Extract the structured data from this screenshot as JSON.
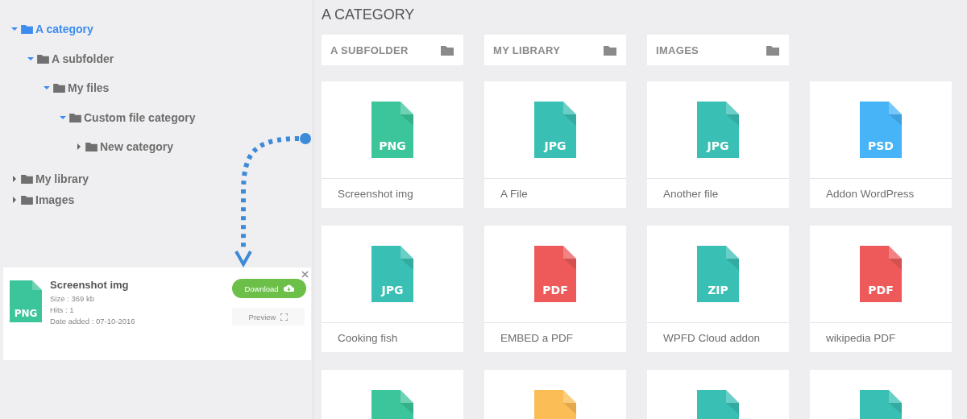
{
  "tree": [
    {
      "label": "A category",
      "selected": true,
      "expanded": true,
      "children": [
        {
          "label": "A subfolder",
          "selected": false,
          "expanded": true,
          "children": [
            {
              "label": "My files",
              "selected": false,
              "expanded": true,
              "children": [
                {
                  "label": "Custom file category",
                  "selected": false,
                  "expanded": true,
                  "children": [
                    {
                      "label": "New category",
                      "selected": false,
                      "expanded": false
                    }
                  ]
                }
              ]
            }
          ]
        }
      ]
    },
    {
      "label": "My library",
      "selected": false,
      "expanded": false
    },
    {
      "label": "Images",
      "selected": false,
      "expanded": false
    }
  ],
  "preview": {
    "title": "Screenshot img",
    "ext": "PNG",
    "color": "#3cc49a",
    "size": "Size : 369 kb",
    "hits": "Hits : 1",
    "date": "Date added : 07-10-2016",
    "download": "Download",
    "preview_button": "Preview"
  },
  "content": {
    "title": "A CATEGORY",
    "folders": [
      {
        "label": "A SUBFOLDER"
      },
      {
        "label": "MY LIBRARY"
      },
      {
        "label": "IMAGES"
      }
    ],
    "files": [
      {
        "name": "Screenshot img",
        "ext": "PNG",
        "color": "#3cc49a"
      },
      {
        "name": "A File",
        "ext": "JPG",
        "color": "#39bfb3"
      },
      {
        "name": "Another file",
        "ext": "JPG",
        "color": "#39bfb3"
      },
      {
        "name": "Addon WordPress",
        "ext": "PSD",
        "color": "#46b4f6"
      },
      {
        "name": "Cooking fish",
        "ext": "JPG",
        "color": "#39bfb3"
      },
      {
        "name": "EMBED a PDF",
        "ext": "PDF",
        "color": "#ee5a5a"
      },
      {
        "name": "WPFD Cloud addon",
        "ext": "ZIP",
        "color": "#39bfb3"
      },
      {
        "name": "wikipedia PDF",
        "ext": "PDF",
        "color": "#ee5a5a"
      },
      {
        "color": "#3cc49a"
      },
      {
        "color": "#fbbd55"
      },
      {
        "color": "#39bfb3"
      },
      {
        "color": "#39bfb3"
      }
    ]
  }
}
